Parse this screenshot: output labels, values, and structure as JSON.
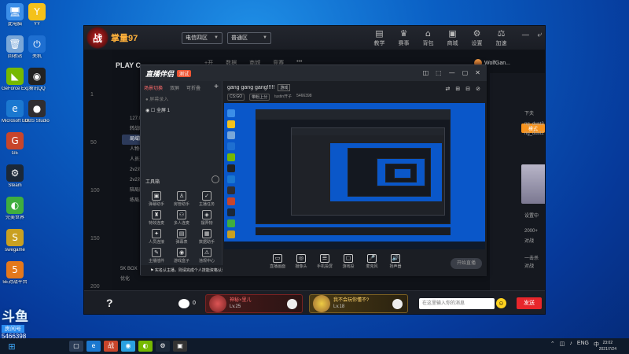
{
  "desktop": {
    "icons": [
      {
        "label": "此电脑",
        "glyph": "🖥",
        "color": "#3b8ee8"
      },
      {
        "label": "YY",
        "glyph": "Y",
        "color": "#f4c21b"
      },
      {
        "label": "回收站",
        "glyph": "🗑",
        "color": "#7aa7d8"
      },
      {
        "label": "关机",
        "glyph": "⏻",
        "color": "#1e6fd1"
      },
      {
        "label": "GeForce Experience",
        "glyph": "◣",
        "color": "#76b900"
      },
      {
        "label": "腾讯QQ",
        "glyph": "◉",
        "color": "#222"
      },
      {
        "label": "Microsoft Edge",
        "glyph": "e",
        "color": "#1b78d0"
      },
      {
        "label": "OBS Studio",
        "glyph": "●",
        "color": "#302e31"
      },
      {
        "label": "GE",
        "glyph": "G",
        "color": "#c8452b"
      },
      {
        "label": "",
        "glyph": "",
        "color": "transparent"
      },
      {
        "label": "Steam",
        "glyph": "⚙",
        "color": "#1b2838"
      },
      {
        "label": "",
        "glyph": "",
        "color": "transparent"
      },
      {
        "label": "完美世界",
        "glyph": "◐",
        "color": "#3fae3f"
      },
      {
        "label": "",
        "glyph": "",
        "color": "transparent"
      },
      {
        "label": "swegame",
        "glyph": "S",
        "color": "#c9a021"
      },
      {
        "label": "",
        "glyph": "",
        "color": "transparent"
      },
      {
        "label": "5E对战平台",
        "glyph": "5",
        "color": "#e4781c"
      },
      {
        "label": "",
        "glyph": "",
        "color": "transparent"
      }
    ]
  },
  "app": {
    "brand": "掌量97",
    "logo": "战",
    "region_select": "电信四区",
    "mode_select": "普通区",
    "nav": [
      {
        "glyph": "▤",
        "label": "教学"
      },
      {
        "glyph": "♛",
        "label": "赛事"
      },
      {
        "glyph": "⌂",
        "label": "背包"
      },
      {
        "glyph": "▣",
        "label": "商城"
      },
      {
        "glyph": "⚙",
        "label": "设置"
      },
      {
        "glyph": "⚖",
        "label": "加速"
      }
    ],
    "window_controls": [
      "—",
      "⤶"
    ],
    "rail_numbers": [
      "1",
      "50",
      "100",
      "150",
      "200"
    ],
    "game_title": "PLAY C",
    "game_tabs": [
      "+开",
      "数据",
      "商城",
      "竞赛",
      "•••"
    ],
    "categories": [
      "127.0",
      "转战时节",
      "局域图",
      "人物公",
      "人员对",
      "2v2对",
      "2v2对",
      "陪局图",
      "练局上"
    ],
    "bottom_left_badge": "5K BOX",
    "bottom_left_badge2": "优化",
    "user_name": "WolfGan...",
    "orange_button": "模式",
    "side_texts": [
      "下夫",
      "ng_dust2",
      "ng_dust2",
      "设置中",
      "2000+",
      "对战",
      "一击杀",
      "对战"
    ],
    "bottom": {
      "help": "?",
      "count": "0",
      "cards": [
        {
          "name": "神秘×里儿",
          "level": "Lv.25"
        },
        {
          "name": "我不会玩你懂不?",
          "level": "Lv.18"
        }
      ],
      "chat_placeholder": "在这里输入你的消息",
      "emoji": "☺",
      "send": "发送"
    }
  },
  "streamer": {
    "logo": "直播伴侣",
    "tag": "测试",
    "window_controls": [
      "◫",
      "⬚",
      "—",
      "▢",
      "✕"
    ],
    "tabs": [
      "场景切换",
      "双屏",
      "可折叠"
    ],
    "add": "+",
    "subtitle": "● 屏幕录入",
    "scene": "◉ ☐ 全屏 1",
    "tools_title": "工具箱",
    "tools": [
      {
        "glyph": "▣",
        "label": "弹幕助手"
      },
      {
        "glyph": "♙",
        "label": "房管助手"
      },
      {
        "glyph": "✓",
        "label": "主播任务"
      },
      {
        "glyph": "♜",
        "label": "特效连麦"
      },
      {
        "glyph": "⚇",
        "label": "多人连麦"
      },
      {
        "glyph": "◈",
        "label": "摆弄物"
      },
      {
        "glyph": "✦",
        "label": "人员连接"
      },
      {
        "glyph": "▤",
        "label": "弹幕表"
      },
      {
        "glyph": "▦",
        "label": "数据助手"
      },
      {
        "glyph": "✎",
        "label": "主播插件"
      },
      {
        "glyph": "◉",
        "label": "游戏盒子"
      },
      {
        "glyph": "⚠",
        "label": "违规中心"
      }
    ],
    "notice": "⚑ 实名认主播，则请完成个人技能资格认证",
    "room_title": "gang gang gang!!!!!",
    "room_tag": "游戏",
    "room_meta": [
      "CS:GO",
      "带粉上分",
      "tustin开子",
      "5466398"
    ],
    "right_icons": [
      "⇄",
      "⊞",
      "⊟",
      "⊘"
    ],
    "controls": [
      {
        "glyph": "▭",
        "label": "直播画面"
      },
      {
        "glyph": "◎",
        "label": "摄像头"
      },
      {
        "glyph": "☰",
        "label": "手机投屏"
      },
      {
        "glyph": "▢",
        "label": "游戏投"
      },
      {
        "glyph": "🎤",
        "label": "麦克风"
      },
      {
        "glyph": "🔊",
        "label": "扬声器"
      }
    ],
    "start": "开始直播"
  },
  "watermark": {
    "title": "斗鱼",
    "sub": "房间号",
    "number": "5466398"
  },
  "taskbar": {
    "start": "⊞",
    "apps": [
      {
        "glyph": "▢",
        "color": "#2a3b55"
      },
      {
        "glyph": "e",
        "color": "#1b78d0"
      },
      {
        "glyph": "战",
        "color": "#c8452b"
      },
      {
        "glyph": "◉",
        "color": "#2aa0e0"
      },
      {
        "glyph": "◐",
        "color": "#76b900"
      },
      {
        "glyph": "⚙",
        "color": "#1b2838"
      },
      {
        "glyph": "▣",
        "color": "#333"
      }
    ],
    "tray": [
      "⌃",
      "◫",
      "♪",
      "ENG",
      "中"
    ],
    "time": "23:02",
    "date": "2021/7/24"
  }
}
